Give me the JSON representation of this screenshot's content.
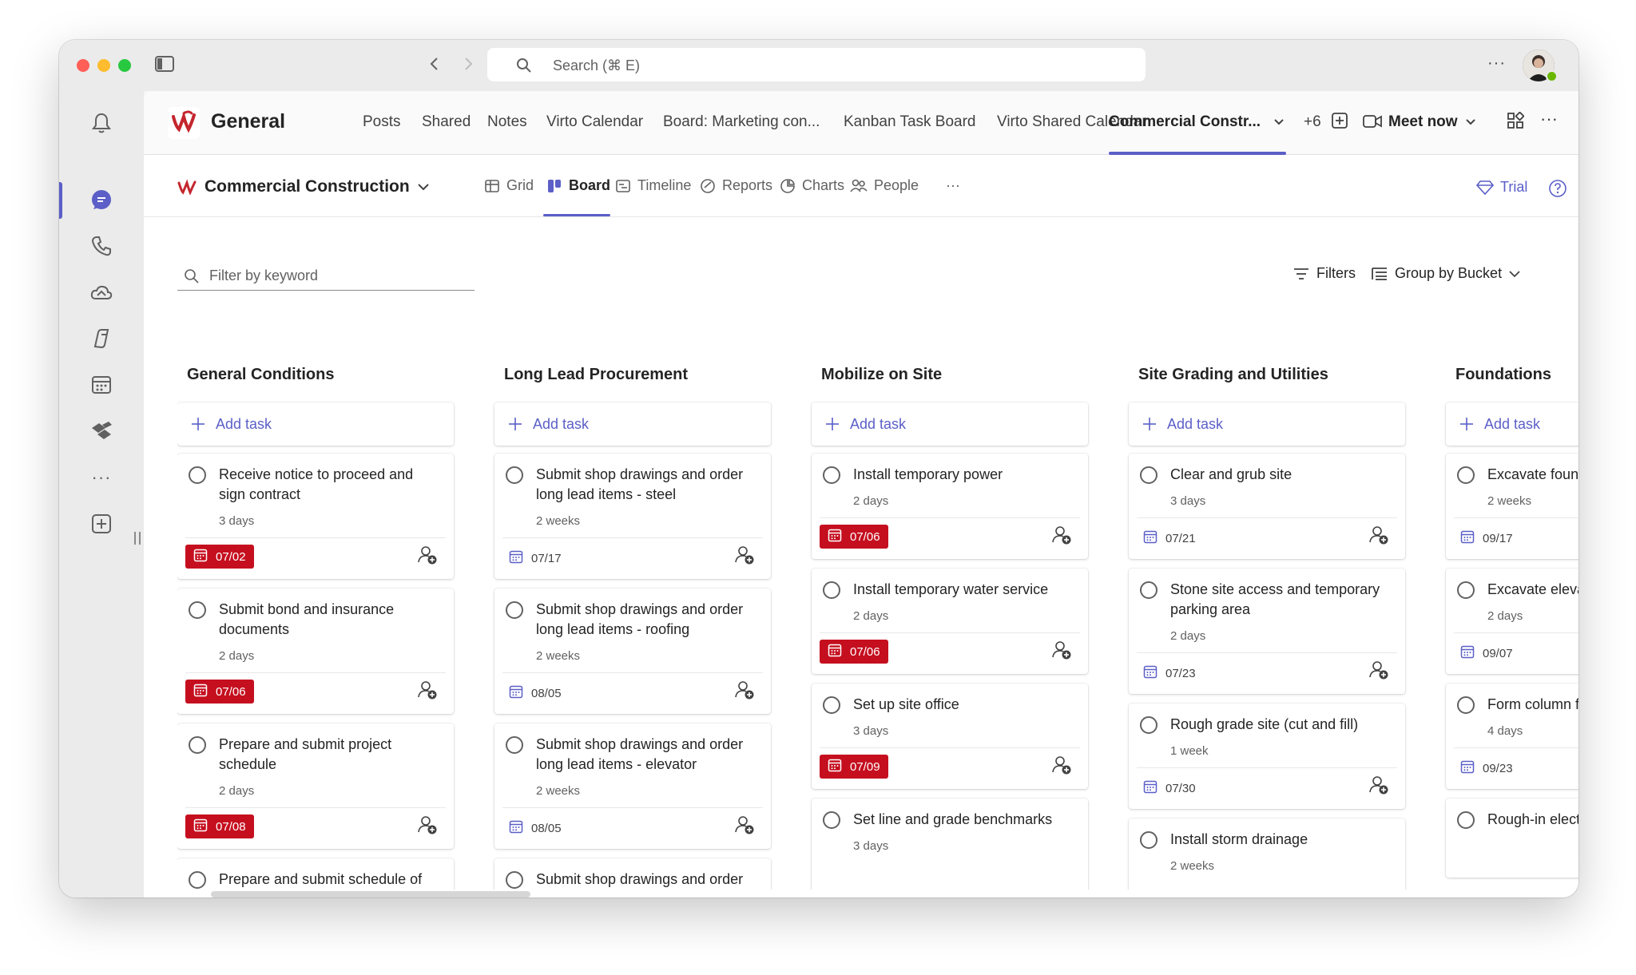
{
  "titlebar": {
    "search_placeholder": "Search (⌘ E)"
  },
  "channel": {
    "title": "General",
    "tabs": [
      {
        "label": "Posts"
      },
      {
        "label": "Shared"
      },
      {
        "label": "Notes"
      },
      {
        "label": "Virto Calendar"
      },
      {
        "label": "Board: Marketing con..."
      },
      {
        "label": "Kanban Task Board"
      },
      {
        "label": "Virto Shared Calendar"
      },
      {
        "label": "Commercial Constr..."
      }
    ],
    "more_tabs": "+6",
    "meet_now": "Meet now"
  },
  "app": {
    "title": "Commercial Construction",
    "views": [
      {
        "label": "Grid",
        "icon": "grid-icon"
      },
      {
        "label": "Board",
        "icon": "board-icon"
      },
      {
        "label": "Timeline",
        "icon": "timeline-icon"
      },
      {
        "label": "Reports",
        "icon": "reports-icon"
      },
      {
        "label": "Charts",
        "icon": "charts-icon"
      },
      {
        "label": "People",
        "icon": "people-icon"
      }
    ],
    "more": "···",
    "trial": "Trial"
  },
  "toolbar": {
    "filter_placeholder": "Filter by keyword",
    "filters": "Filters",
    "group_by": "Group by Bucket"
  },
  "colors": {
    "accent": "#5b5fc7",
    "overdue": "#c50f1f"
  },
  "board": {
    "add_task": "Add task",
    "columns": [
      {
        "title": "General Conditions",
        "cards": [
          {
            "title": "Receive notice to proceed and sign contract",
            "duration": "3 days",
            "date": "07/02",
            "overdue": true
          },
          {
            "title": "Submit bond and insurance documents",
            "duration": "2 days",
            "date": "07/06",
            "overdue": true
          },
          {
            "title": "Prepare and submit project schedule",
            "duration": "2 days",
            "date": "07/08",
            "overdue": true
          },
          {
            "title": "Prepare and submit schedule of values",
            "duration": "",
            "date": "",
            "overdue": false
          }
        ]
      },
      {
        "title": "Long Lead Procurement",
        "cards": [
          {
            "title": "Submit shop drawings and order long lead items - steel",
            "duration": "2 weeks",
            "date": "07/17",
            "overdue": false
          },
          {
            "title": "Submit shop drawings and order long lead items - roofing",
            "duration": "2 weeks",
            "date": "08/05",
            "overdue": false
          },
          {
            "title": "Submit shop drawings and order long lead items - elevator",
            "duration": "2 weeks",
            "date": "08/05",
            "overdue": false
          },
          {
            "title": "Submit shop drawings and order long lead items - plumbing",
            "duration": "",
            "date": "",
            "overdue": false
          }
        ]
      },
      {
        "title": "Mobilize on Site",
        "cards": [
          {
            "title": "Install temporary power",
            "duration": "2 days",
            "date": "07/06",
            "overdue": true
          },
          {
            "title": "Install temporary water service",
            "duration": "2 days",
            "date": "07/06",
            "overdue": true
          },
          {
            "title": "Set up site office",
            "duration": "3 days",
            "date": "07/09",
            "overdue": true
          },
          {
            "title": "Set line and grade benchmarks",
            "duration": "3 days",
            "date": "",
            "overdue": false
          }
        ]
      },
      {
        "title": "Site Grading and Utilities",
        "cards": [
          {
            "title": "Clear and grub site",
            "duration": "3 days",
            "date": "07/21",
            "overdue": false
          },
          {
            "title": "Stone site access and temporary parking area",
            "duration": "2 days",
            "date": "07/23",
            "overdue": false
          },
          {
            "title": "Rough grade site (cut and fill)",
            "duration": "1 week",
            "date": "07/30",
            "overdue": false
          },
          {
            "title": "Install storm drainage",
            "duration": "2 weeks",
            "date": "",
            "overdue": false
          }
        ]
      },
      {
        "title": "Foundations",
        "cards": [
          {
            "title": "Excavate foundations",
            "duration": "2 weeks",
            "date": "09/17",
            "overdue": false
          },
          {
            "title": "Excavate elevator pit",
            "duration": "2 days",
            "date": "09/07",
            "overdue": false
          },
          {
            "title": "Form column foundations",
            "duration": "4 days",
            "date": "09/23",
            "overdue": false
          },
          {
            "title": "Rough-in electrical in elevator",
            "duration": "",
            "date": "",
            "overdue": false
          }
        ]
      }
    ]
  }
}
